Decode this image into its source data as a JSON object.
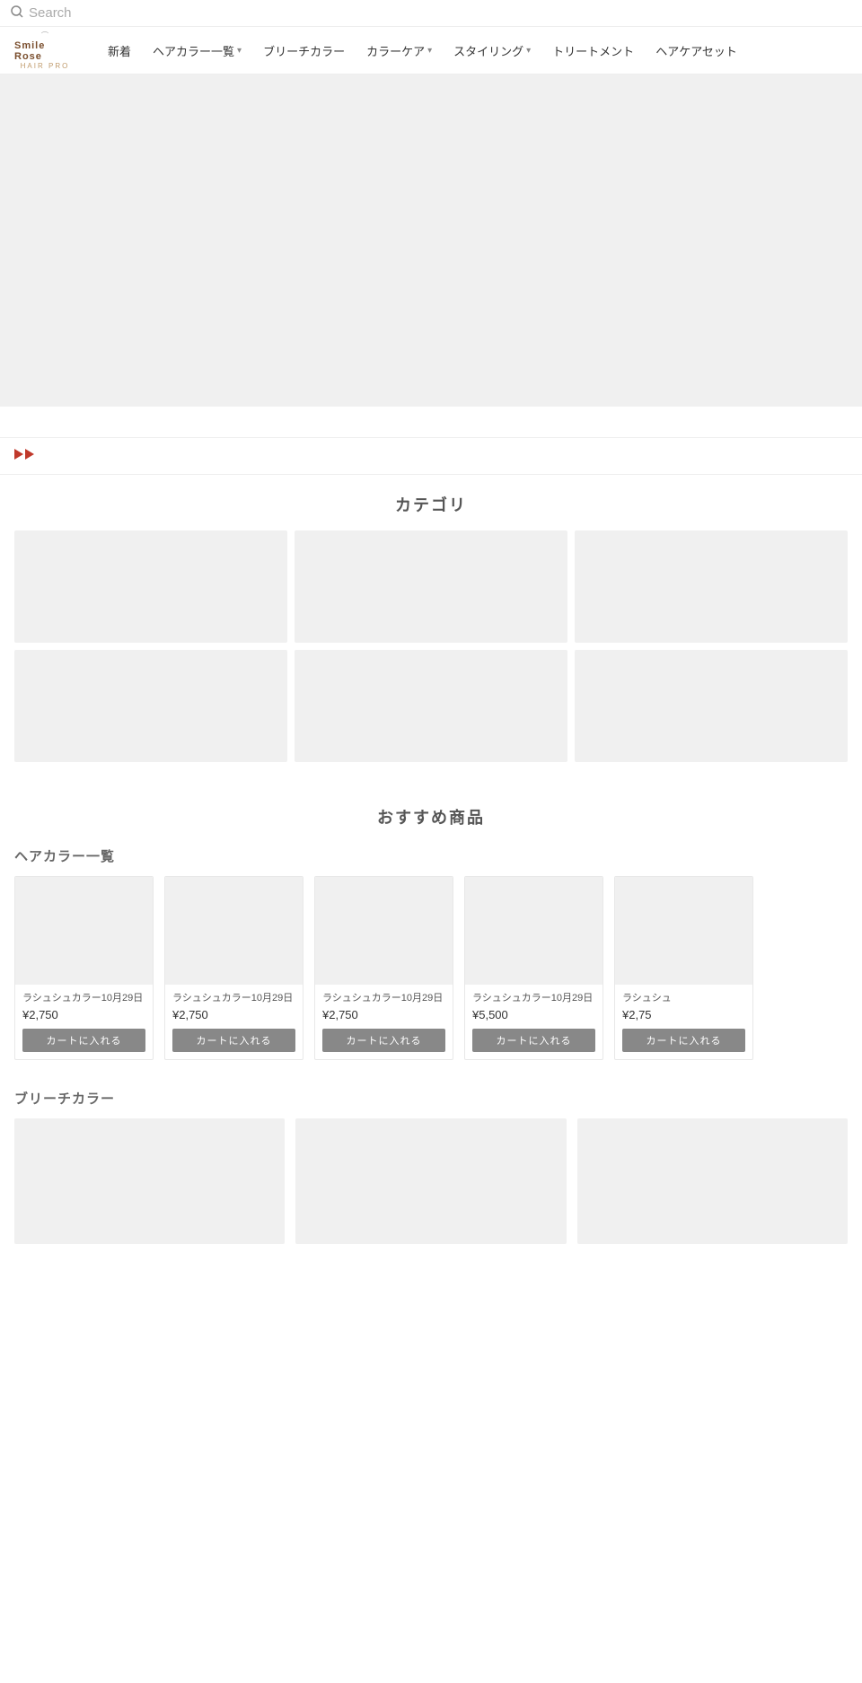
{
  "topbar": {
    "search_placeholder": "Search"
  },
  "navbar": {
    "logo_title": "Smile Rose",
    "logo_subtitle": "HAIR PRO",
    "items": [
      {
        "label": "新着",
        "has_dropdown": false
      },
      {
        "label": "ヘアカラー一覧",
        "has_dropdown": true
      },
      {
        "label": "ブリーチカラー",
        "has_dropdown": false
      },
      {
        "label": "カラーケア",
        "has_dropdown": true
      },
      {
        "label": "スタイリング",
        "has_dropdown": true
      },
      {
        "label": "トリートメント",
        "has_dropdown": false
      },
      {
        "label": "ヘアケアセット",
        "has_dropdown": false
      }
    ]
  },
  "category_section": {
    "title": "カテゴリ",
    "cards": [
      {},
      {},
      {},
      {},
      {},
      {}
    ]
  },
  "products_section": {
    "main_title": "おすすめ商品",
    "groups": [
      {
        "title": "ヘアカラー一覧",
        "products": [
          {
            "name": "ラシュシュカラー10月29日",
            "price": "¥2,750",
            "btn_label": "カートに入れる"
          },
          {
            "name": "ラシュシュカラー10月29日",
            "price": "¥2,750",
            "btn_label": "カートに入れる"
          },
          {
            "name": "ラシュシュカラー10月29日",
            "price": "¥2,750",
            "btn_label": "カートに入れる"
          },
          {
            "name": "ラシュシュカラー10月29日",
            "price": "¥5,500",
            "btn_label": "カートに入れる"
          },
          {
            "name": "ラシュシュ",
            "price": "¥2,75",
            "btn_label": "カートに入れる"
          }
        ]
      },
      {
        "title": "ブリーチカラー",
        "products": [
          {},
          {},
          {}
        ]
      }
    ]
  }
}
